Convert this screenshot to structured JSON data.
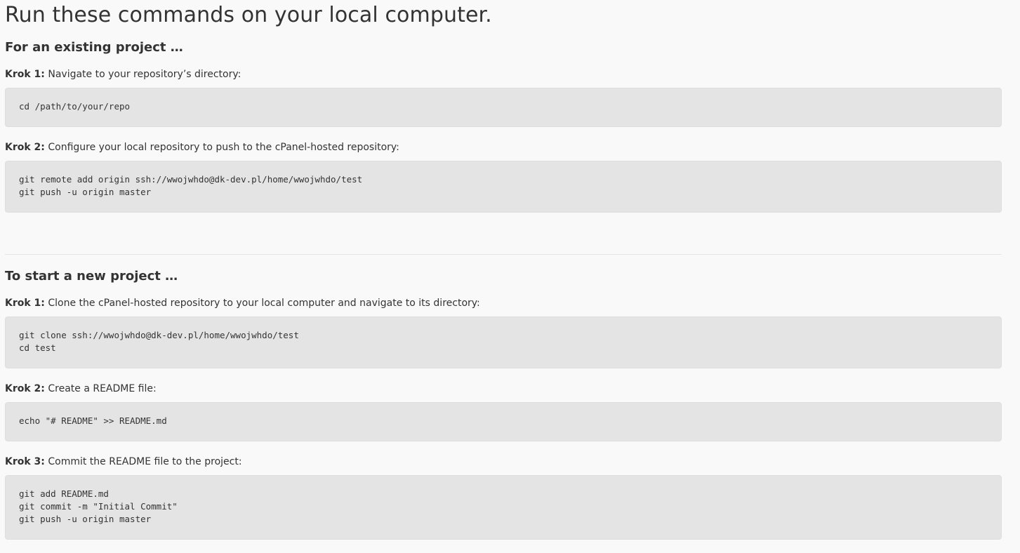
{
  "title": "Run these commands on your local computer.",
  "existing": {
    "heading": "For an existing project …",
    "steps": [
      {
        "label": "Krok 1:",
        "text": " Navigate to your repository’s directory:",
        "code": "cd /path/to/your/repo"
      },
      {
        "label": "Krok 2:",
        "text": " Configure your local repository to push to the cPanel-hosted repository:",
        "code": "git remote add origin ssh://wwojwhdo@dk-dev.pl/home/wwojwhdo/test\ngit push -u origin master"
      }
    ]
  },
  "new_project": {
    "heading": "To start a new project …",
    "steps": [
      {
        "label": "Krok 1:",
        "text": " Clone the cPanel-hosted repository to your local computer and navigate to its directory:",
        "code": "git clone ssh://wwojwhdo@dk-dev.pl/home/wwojwhdo/test\ncd test"
      },
      {
        "label": "Krok 2:",
        "text": " Create a README file:",
        "code": "echo \"# README\" >> README.md"
      },
      {
        "label": "Krok 3:",
        "text": " Commit the README file to the project:",
        "code": "git add README.md\ngit commit -m \"Initial Commit\"\ngit push -u origin master"
      }
    ]
  }
}
